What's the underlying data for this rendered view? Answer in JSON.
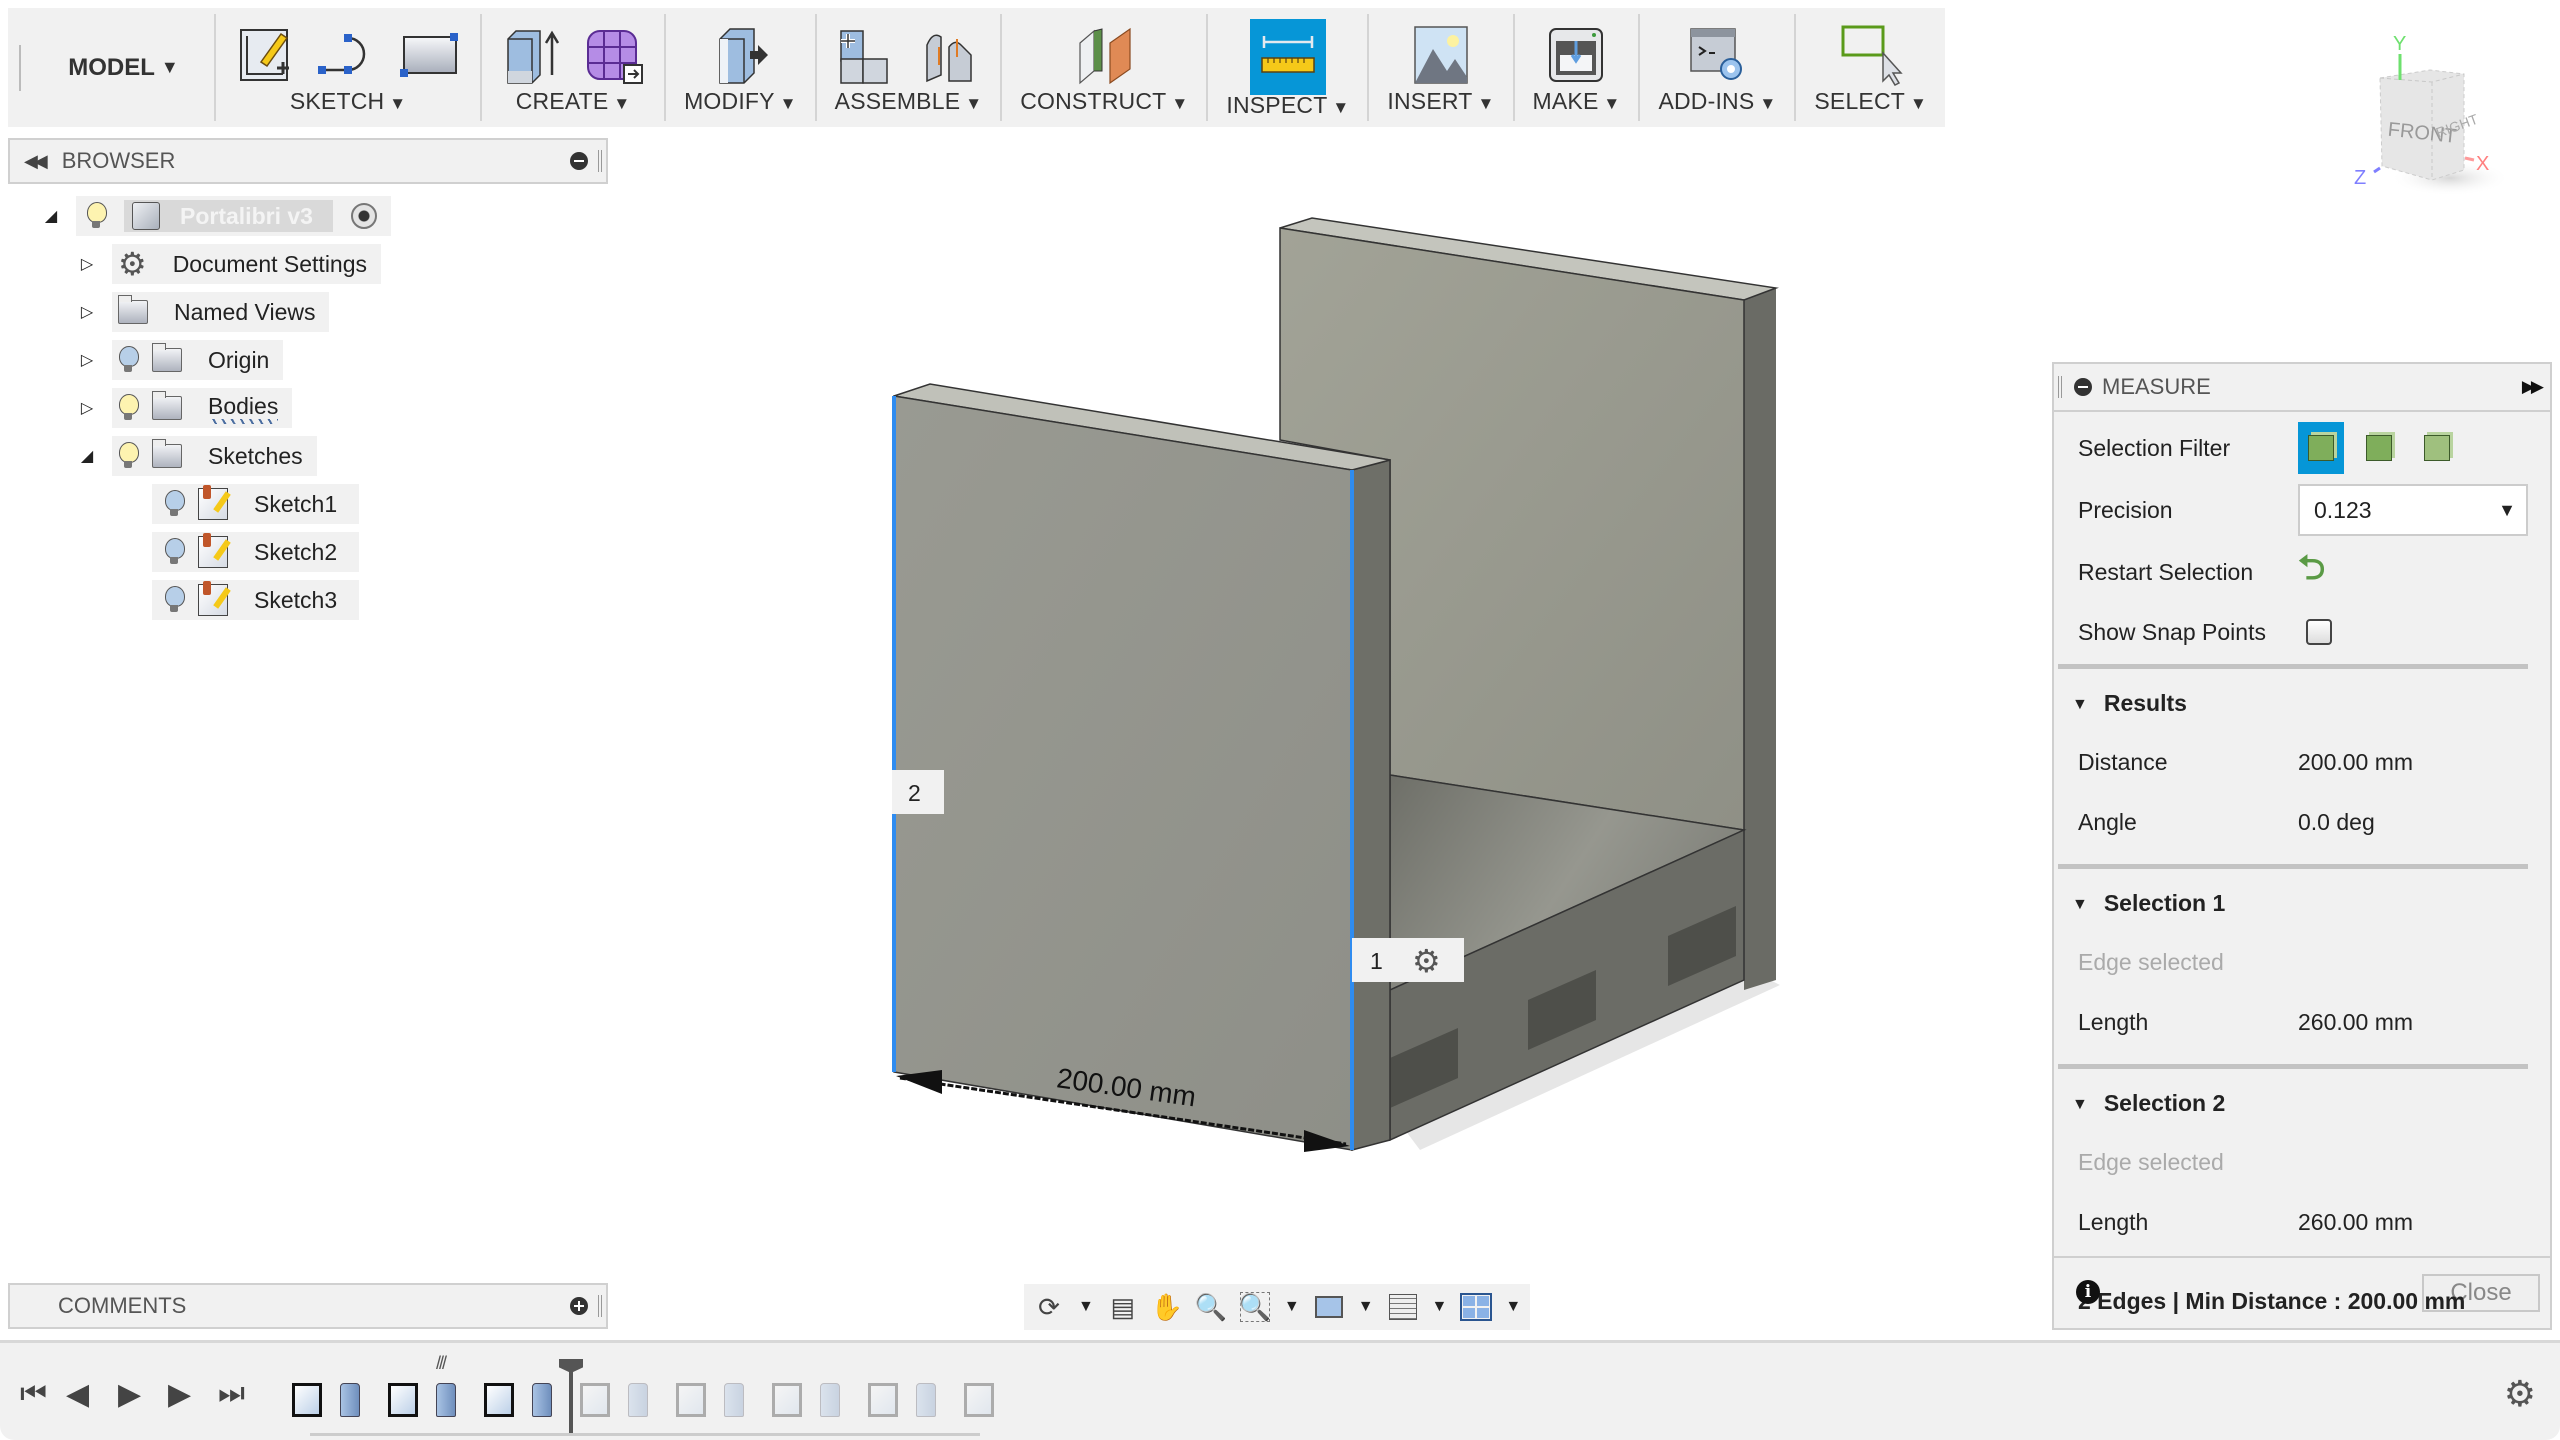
{
  "toolbar": {
    "workspace": "MODEL",
    "groups": [
      {
        "label": "SKETCH"
      },
      {
        "label": "CREATE"
      },
      {
        "label": "MODIFY"
      },
      {
        "label": "ASSEMBLE"
      },
      {
        "label": "CONSTRUCT"
      },
      {
        "label": "INSPECT"
      },
      {
        "label": "INSERT"
      },
      {
        "label": "MAKE"
      },
      {
        "label": "ADD-INS"
      },
      {
        "label": "SELECT"
      }
    ],
    "active_group": "INSPECT",
    "accent_color": "#0696d7"
  },
  "browser": {
    "title": "BROWSER",
    "root": {
      "label": "Portalibri v3"
    },
    "items": [
      {
        "label": "Document Settings",
        "icon": "gear-icon",
        "expanded": false
      },
      {
        "label": "Named Views",
        "icon": "folder-icon",
        "expanded": false
      },
      {
        "label": "Origin",
        "icon": "folder-icon",
        "visible": false,
        "expanded": false
      },
      {
        "label": "Bodies",
        "icon": "folder-icon",
        "visible": true,
        "expanded": false
      },
      {
        "label": "Sketches",
        "icon": "folder-icon",
        "visible": true,
        "expanded": true
      }
    ],
    "sketches": [
      {
        "label": "Sketch1"
      },
      {
        "label": "Sketch2"
      },
      {
        "label": "Sketch3"
      }
    ]
  },
  "comments": {
    "title": "COMMENTS"
  },
  "viewport": {
    "dimension_label": "200.00 mm",
    "selection_markers": [
      "1",
      "2"
    ],
    "viewcube": {
      "front": "FRONT",
      "right": "RIGHT",
      "axes": [
        "X",
        "Y",
        "Z"
      ]
    }
  },
  "measure": {
    "title": "MEASURE",
    "selection_filter_label": "Selection Filter",
    "precision_label": "Precision",
    "precision_value": "0.123",
    "restart_label": "Restart Selection",
    "snap_label": "Show Snap Points",
    "snap_checked": false,
    "results": {
      "title": "Results",
      "distance_label": "Distance",
      "distance_value": "200.00 mm",
      "angle_label": "Angle",
      "angle_value": "0.0 deg"
    },
    "selection1": {
      "title": "Selection 1",
      "status": "Edge selected",
      "length_label": "Length",
      "length_value": "260.00 mm"
    },
    "selection2": {
      "title": "Selection 2",
      "status": "Edge selected",
      "length_label": "Length",
      "length_value": "260.00 mm"
    },
    "footer": "2 Edges | Min Distance : 200.00 mm",
    "close_label": "Close"
  },
  "timeline": {
    "active_steps": 6,
    "total_steps": 15
  }
}
